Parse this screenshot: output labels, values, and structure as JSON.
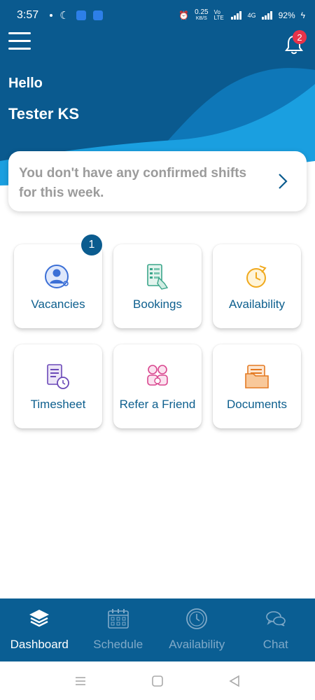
{
  "status_bar": {
    "time": "3:57",
    "network_speed_value": "0.25",
    "network_speed_unit": "KB/S",
    "volte": "Vo LTE",
    "net_type": "4G",
    "battery": "92%"
  },
  "header": {
    "greeting": "Hello",
    "user_name": "Tester KS",
    "notifications_count": "2"
  },
  "shift_card": {
    "message": "You don't have any confirmed shifts for this week."
  },
  "tiles": [
    {
      "label": "Vacancies",
      "icon": "person-search-icon",
      "badge": "1"
    },
    {
      "label": "Bookings",
      "icon": "checklist-tap-icon"
    },
    {
      "label": "Availability",
      "icon": "clock-refresh-icon"
    },
    {
      "label": "Timesheet",
      "icon": "timesheet-clock-icon"
    },
    {
      "label": "Refer a Friend",
      "icon": "people-icon"
    },
    {
      "label": "Documents",
      "icon": "folder-documents-icon"
    }
  ],
  "bottom_nav": [
    {
      "label": "Dashboard",
      "icon": "layers-icon",
      "active": true
    },
    {
      "label": "Schedule",
      "icon": "calendar-icon"
    },
    {
      "label": "Availability",
      "icon": "clock-icon"
    },
    {
      "label": "Chat",
      "icon": "chat-bubbles-icon"
    }
  ],
  "colors": {
    "primary": "#0a5e93",
    "accent_light": "#2aa6e0",
    "badge_red": "#e8334a",
    "tile_text": "#0d5f8e"
  }
}
